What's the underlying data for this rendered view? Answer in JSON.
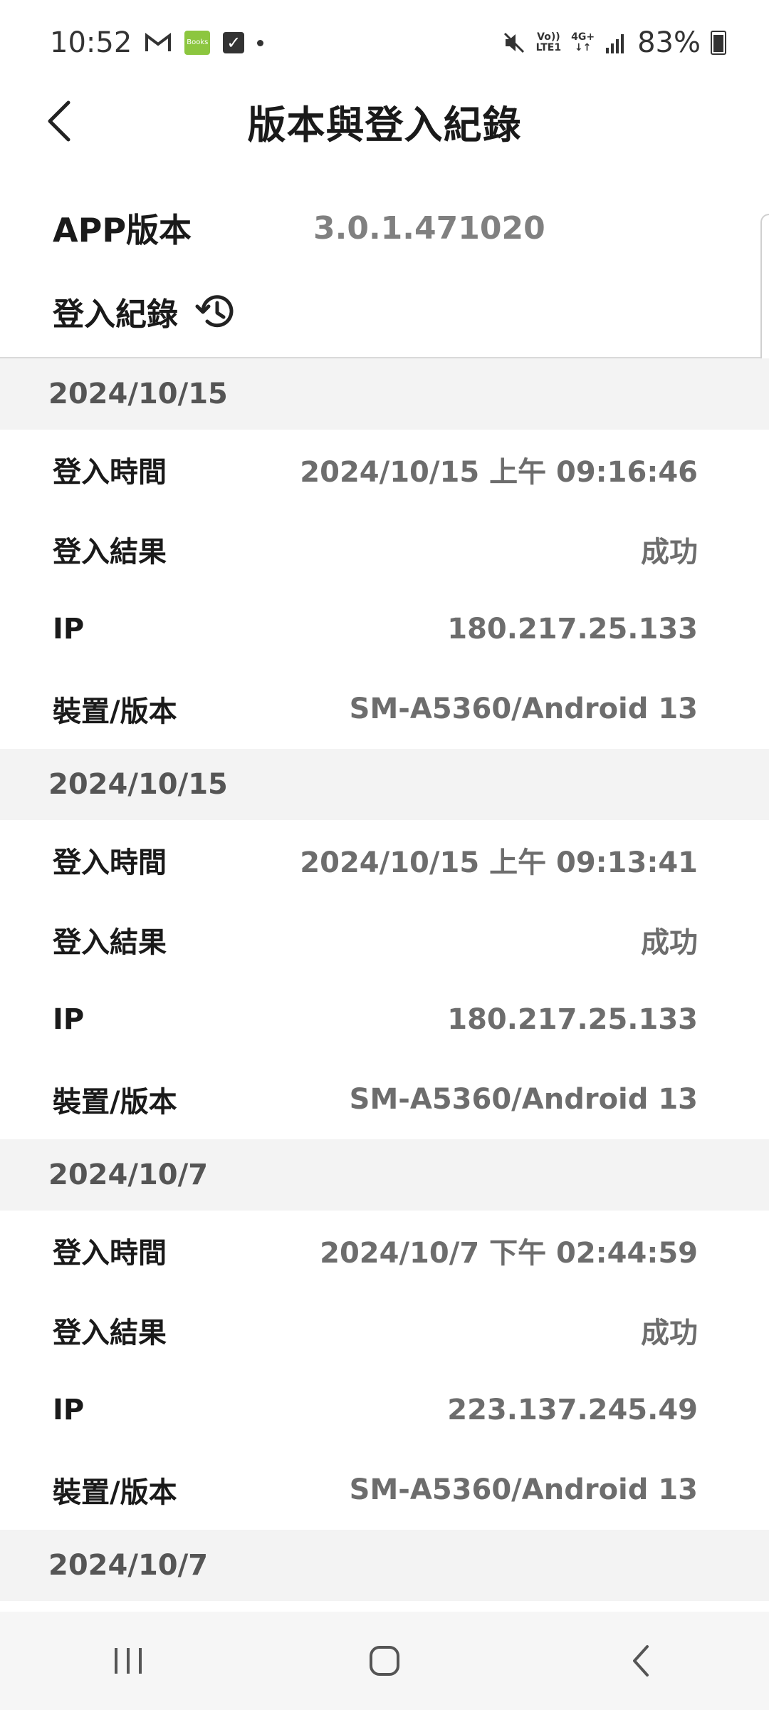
{
  "status_bar": {
    "time": "10:52",
    "battery": "83%",
    "app_badge": "Books",
    "network_top": "Vo))",
    "network_bottom": "LTE1",
    "network_type": "4G+"
  },
  "header": {
    "title": "版本與登入紀錄"
  },
  "version": {
    "label": "APP版本",
    "value": "3.0.1.471020"
  },
  "history": {
    "label": "登入紀錄"
  },
  "records": [
    {
      "date": "2024/10/15",
      "rows": [
        {
          "label": "登入時間",
          "value": "2024/10/15 上午 09:16:46"
        },
        {
          "label": "登入結果",
          "value": "成功"
        },
        {
          "label": "IP",
          "value": "180.217.25.133"
        },
        {
          "label": "裝置/版本",
          "value": "SM-A5360/Android 13"
        }
      ]
    },
    {
      "date": "2024/10/15",
      "rows": [
        {
          "label": "登入時間",
          "value": "2024/10/15 上午 09:13:41"
        },
        {
          "label": "登入結果",
          "value": "成功"
        },
        {
          "label": "IP",
          "value": "180.217.25.133"
        },
        {
          "label": "裝置/版本",
          "value": "SM-A5360/Android 13"
        }
      ]
    },
    {
      "date": "2024/10/7",
      "rows": [
        {
          "label": "登入時間",
          "value": "2024/10/7 下午 02:44:59"
        },
        {
          "label": "登入結果",
          "value": "成功"
        },
        {
          "label": "IP",
          "value": "223.137.245.49"
        },
        {
          "label": "裝置/版本",
          "value": "SM-A5360/Android 13"
        }
      ]
    },
    {
      "date": "2024/10/7",
      "rows": []
    }
  ],
  "nav": {
    "recents": "recents-icon",
    "home": "home-icon",
    "back": "back-icon"
  }
}
